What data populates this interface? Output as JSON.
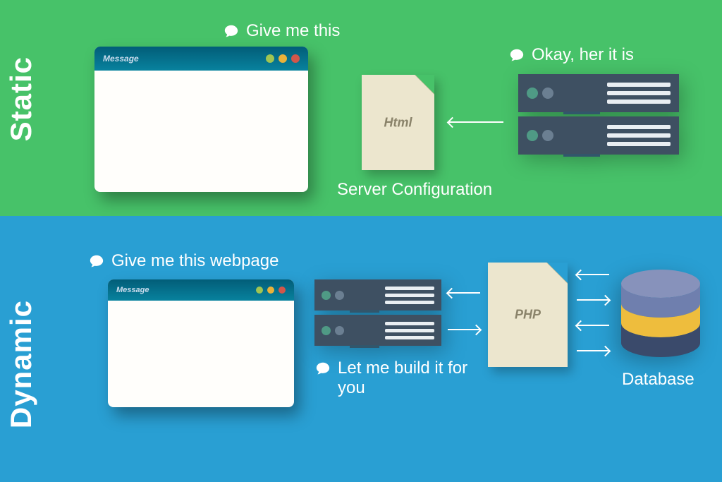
{
  "static": {
    "section_label": "Static",
    "speech_request": "Give me this",
    "speech_response": "Okay, her it is",
    "browser_title": "Message",
    "file_label": "Html",
    "caption": "Server Configuration"
  },
  "dynamic": {
    "section_label": "Dynamic",
    "speech_request": "Give me this webpage",
    "speech_response": "Let me build it for you",
    "browser_title": "Message",
    "file_label": "PHP",
    "db_label": "Database"
  },
  "colors": {
    "static_bg": "#47c269",
    "dynamic_bg": "#299fd3",
    "server_body": "#3e5062",
    "file_bg": "#ece6ce",
    "db_top": "#6f7fae",
    "db_mid": "#eebd3d",
    "db_bot": "#3a4a6b"
  }
}
